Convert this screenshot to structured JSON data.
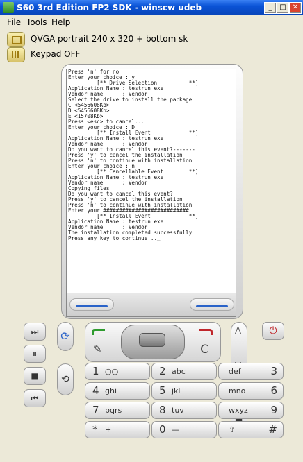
{
  "window": {
    "title": "S60 3rd Edition FP2 SDK - winscw udeb",
    "minimize": "_",
    "maximize": "□",
    "close": "✕"
  },
  "menu": [
    "File",
    "Tools",
    "Help"
  ],
  "options": {
    "resolution": "QVGA portrait 240 x 320 + bottom sk",
    "keypad": "Keypad OFF"
  },
  "console_lines": [
    "Press 'n' for no",
    "Enter your choice : y",
    "",
    "         [** Drive Selection          **]",
    "",
    "Application Name : testrun exe",
    "Vendor name      : Vendor",
    "Select the drive to install the package",
    "C <5456608Kb>",
    "D <5456608Kb>",
    "E <15708Kb>",
    "Press <esc> to cancel...",
    "Enter your choice : D",
    "",
    "         [** Install Event            **]",
    "",
    "Application Name : testrun exe",
    "Vendor name      : Vendor",
    "Do you want to cancel this event?-------",
    "",
    "Press 'y' to cancel the installation",
    "Press 'n' to continue with installation",
    "Enter your choice : n",
    "",
    "         [** Cancellable Event        **]",
    "",
    "Application Name : testrun exe",
    "Vendor name      : Vendor",
    "Copying files",
    "Do you want to cancel this event?",
    "Press 'y' to cancel the installation",
    "Press 'n' to continue with installation",
    "Enter your ###########################",
    "",
    "         [** Install Event            **]",
    "",
    "Application Name : testrun exe",
    "Vendor name      : Vendor",
    "The installation completed successfully",
    "Press any key to continue...▁"
  ],
  "keypad": [
    {
      "num": "1",
      "letters": "○○"
    },
    {
      "num": "2",
      "letters": "abc"
    },
    {
      "num": "3",
      "letters": "def"
    },
    {
      "num": "4",
      "letters": "ghi"
    },
    {
      "num": "5",
      "letters": "jkl"
    },
    {
      "num": "6",
      "letters": "mno"
    },
    {
      "num": "7",
      "letters": "pqrs"
    },
    {
      "num": "8",
      "letters": "tuv"
    },
    {
      "num": "9",
      "letters": "wxyz"
    },
    {
      "num": "*",
      "letters": "+"
    },
    {
      "num": "0",
      "letters": "—"
    },
    {
      "num": "#",
      "letters": "⇧"
    }
  ],
  "nav": {
    "clear_label": "C"
  },
  "media": {
    "next": "⏭",
    "pause": "⏸",
    "stop": "■",
    "prev": "⏮"
  },
  "colors": {
    "call_green": "#2e9b2e",
    "end_red": "#c0262b",
    "softkey_blue": "#2a63c9"
  }
}
